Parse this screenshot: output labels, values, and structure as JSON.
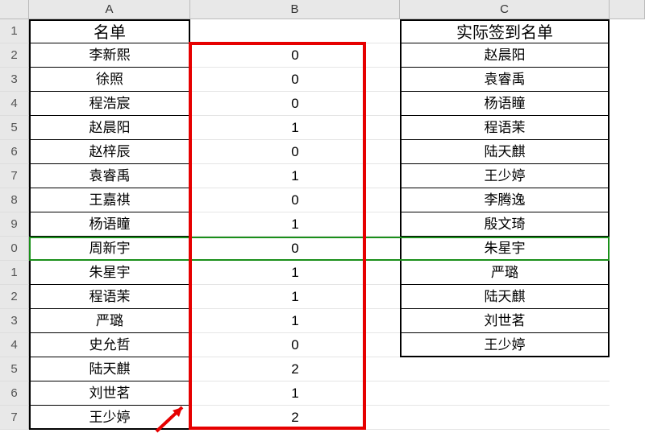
{
  "columns": {
    "A": "A",
    "B": "B",
    "C": "C"
  },
  "header_row_labels": [
    "1",
    "2",
    "3",
    "4",
    "5",
    "6",
    "7",
    "8",
    "9",
    "0",
    "1",
    "2",
    "3",
    "4",
    "5",
    "6",
    "7"
  ],
  "header": {
    "A": "名单",
    "C": "实际签到名单"
  },
  "rows": [
    {
      "A": "李新熙",
      "B": "0",
      "C": "赵晨阳"
    },
    {
      "A": "徐照",
      "B": "0",
      "C": "袁睿禹"
    },
    {
      "A": "程浩宸",
      "B": "0",
      "C": "杨语瞳"
    },
    {
      "A": "赵晨阳",
      "B": "1",
      "C": "程语茉"
    },
    {
      "A": "赵梓辰",
      "B": "0",
      "C": "陆天麒"
    },
    {
      "A": "袁睿禹",
      "B": "1",
      "C": "王少婷"
    },
    {
      "A": "王嘉祺",
      "B": "0",
      "C": "李腾逸"
    },
    {
      "A": "杨语瞳",
      "B": "1",
      "C": "殷文琦"
    },
    {
      "A": "周新宇",
      "B": "0",
      "C": "朱星宇"
    },
    {
      "A": "朱星宇",
      "B": "1",
      "C": "严璐"
    },
    {
      "A": "程语茉",
      "B": "1",
      "C": "陆天麒"
    },
    {
      "A": "严璐",
      "B": "1",
      "C": "刘世茗"
    },
    {
      "A": "史允哲",
      "B": "0",
      "C": "王少婷"
    },
    {
      "A": "陆天麒",
      "B": "2",
      "C": ""
    },
    {
      "A": "刘世茗",
      "B": "1",
      "C": ""
    },
    {
      "A": "王少婷",
      "B": "2",
      "C": ""
    }
  ],
  "chart_data": {
    "type": "table",
    "columns": [
      "名单",
      "B",
      "实际签到名单"
    ],
    "data": [
      [
        "李新熙",
        0,
        "赵晨阳"
      ],
      [
        "徐照",
        0,
        "袁睿禹"
      ],
      [
        "程浩宸",
        0,
        "杨语瞳"
      ],
      [
        "赵晨阳",
        1,
        "程语茉"
      ],
      [
        "赵梓辰",
        0,
        "陆天麒"
      ],
      [
        "袁睿禹",
        1,
        "王少婷"
      ],
      [
        "王嘉祺",
        0,
        "李腾逸"
      ],
      [
        "杨语瞳",
        1,
        "殷文琦"
      ],
      [
        "周新宇",
        0,
        "朱星宇"
      ],
      [
        "朱星宇",
        1,
        "严璐"
      ],
      [
        "程语茉",
        1,
        "陆天麒"
      ],
      [
        "严璐",
        1,
        "刘世茗"
      ],
      [
        "史允哲",
        0,
        "王少婷"
      ],
      [
        "陆天麒",
        2,
        ""
      ],
      [
        "刘世茗",
        1,
        ""
      ],
      [
        "王少婷",
        2,
        ""
      ]
    ]
  }
}
